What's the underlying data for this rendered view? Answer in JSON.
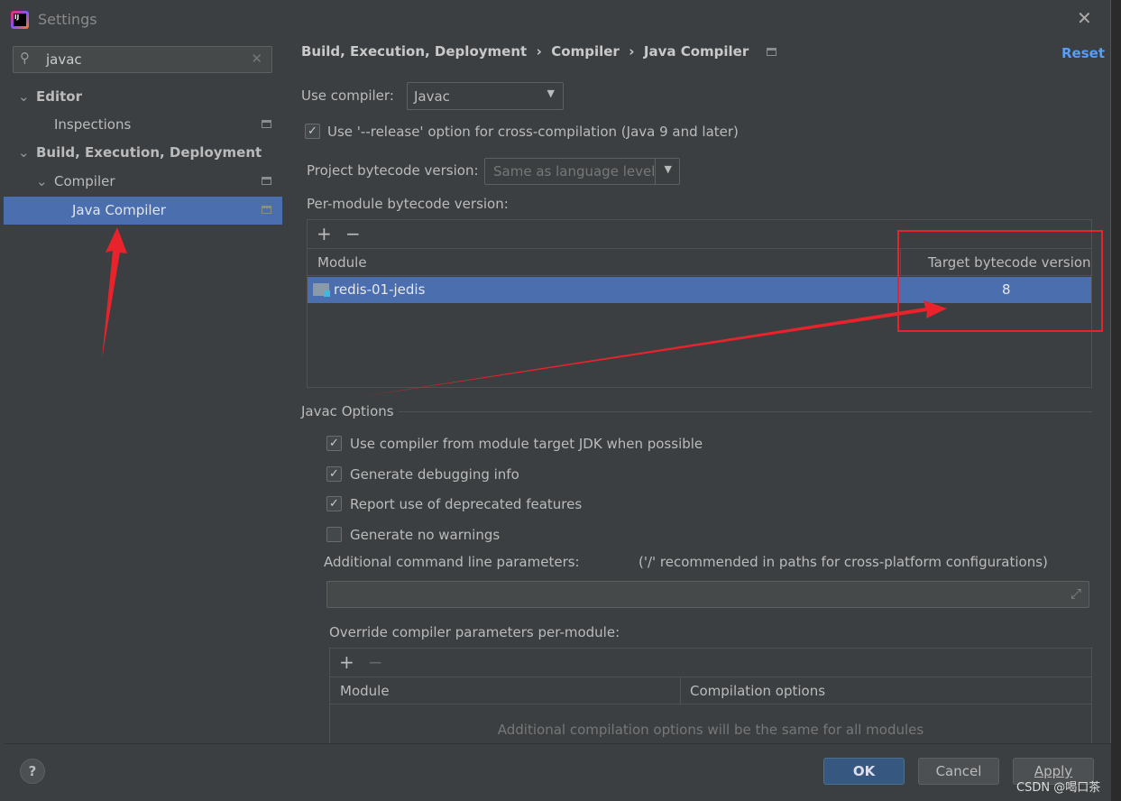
{
  "window": {
    "title": "Settings"
  },
  "search": {
    "value": "javac"
  },
  "tree": [
    {
      "label": "Editor"
    },
    {
      "label": "Inspections"
    },
    {
      "label": "Build, Execution, Deployment"
    },
    {
      "label": "Compiler"
    },
    {
      "label": "Java Compiler"
    }
  ],
  "breadcrumb": [
    "Build, Execution, Deployment",
    "Compiler",
    "Java Compiler"
  ],
  "reset": "Reset",
  "use_compiler": {
    "label": "Use compiler:",
    "value": "Javac"
  },
  "release_option": {
    "label": "Use '--release' option for cross-compilation (Java 9 and later)",
    "checked": true
  },
  "project_bytecode": {
    "label": "Project bytecode version:",
    "value": "Same as language level"
  },
  "per_module": {
    "label": "Per-module bytecode version:",
    "columns": [
      "Module",
      "Target bytecode version"
    ],
    "rows": [
      {
        "module": "redis-01-jedis",
        "version": "8"
      }
    ]
  },
  "javac_options": {
    "title": "Javac Options",
    "checks": [
      {
        "label": "Use compiler from module target JDK when possible",
        "checked": true
      },
      {
        "label": "Generate debugging info",
        "checked": true
      },
      {
        "label": "Report use of deprecated features",
        "checked": true
      },
      {
        "label": "Generate no warnings",
        "checked": false
      }
    ],
    "cmd_label": "Additional command line parameters:",
    "cmd_hint": "('/' recommended in paths for cross-platform configurations)",
    "cmd_value": ""
  },
  "override": {
    "label": "Override compiler parameters per-module:",
    "columns": [
      "Module",
      "Compilation options"
    ],
    "empty": "Additional compilation options will be the same for all modules"
  },
  "buttons": {
    "ok": "OK",
    "cancel": "Cancel",
    "apply": "Apply",
    "help": "?"
  },
  "watermark": "CSDN @喝口茶",
  "annotation_color": "#e8232b"
}
